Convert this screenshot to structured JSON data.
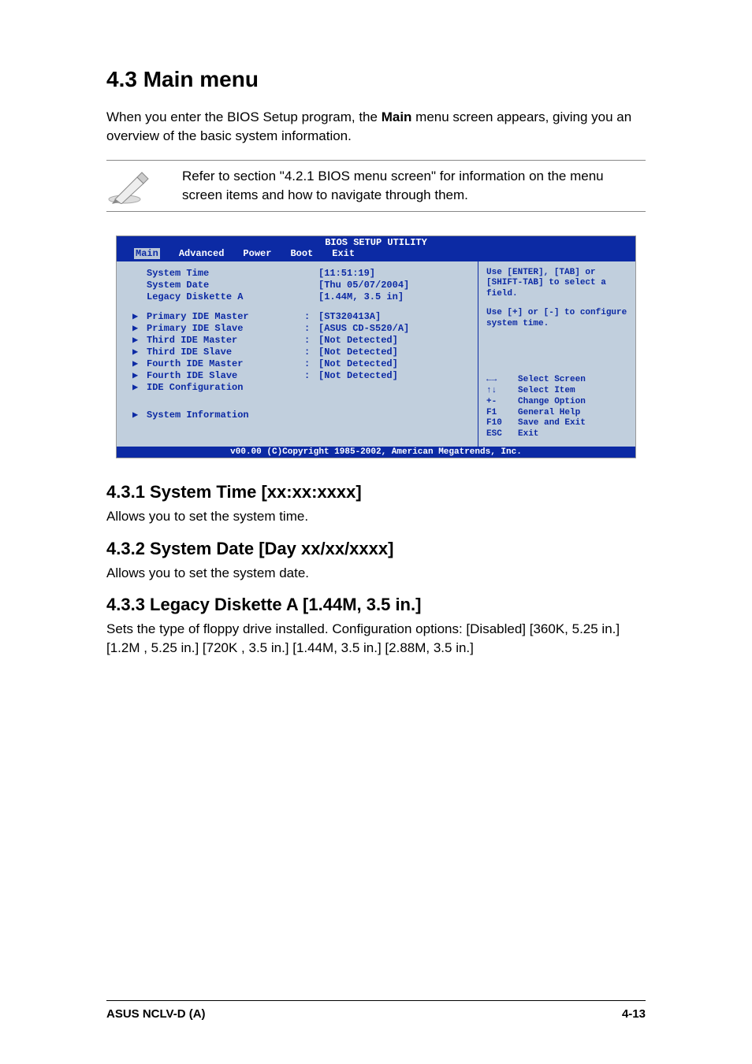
{
  "heading": "4.3    Main menu",
  "intro_pre": "When you enter the BIOS Setup program, the ",
  "intro_bold": "Main",
  "intro_post": " menu screen appears, giving you an overview of the basic system information.",
  "note": "Refer to section \"4.2.1  BIOS menu screen\" for information on the menu screen items and how to navigate through them.",
  "bios": {
    "title": "BIOS SETUP UTILITY",
    "menu": {
      "main": "Main",
      "advanced": "Advanced",
      "power": "Power",
      "boot": "Boot",
      "exit": "Exit"
    },
    "rows_top": [
      {
        "label": "System Time",
        "val": "[11:51:19]"
      },
      {
        "label": "System Date",
        "val": "[Thu 05/07/2004]"
      },
      {
        "label": "Legacy Diskette A",
        "val": "[1.44M, 3.5 in]"
      }
    ],
    "rows_ide": [
      {
        "label": "Primary IDE Master",
        "val": "[ST320413A]"
      },
      {
        "label": "Primary IDE Slave",
        "val": "[ASUS CD-S520/A]"
      },
      {
        "label": "Third IDE Master",
        "val": "[Not Detected]"
      },
      {
        "label": "Third IDE Slave",
        "val": "[Not Detected]"
      },
      {
        "label": "Fourth IDE Master",
        "val": "[Not Detected]"
      },
      {
        "label": "Fourth IDE Slave",
        "val": "[Not Detected]"
      },
      {
        "label": "IDE Configuration",
        "val": ""
      }
    ],
    "rows_sys": [
      {
        "label": "System Information",
        "val": ""
      }
    ],
    "help_top": "Use [ENTER], [TAB] or [SHIFT-TAB] to select a field.",
    "help_mid": "Use [+] or [-] to configure system time.",
    "help_nav": [
      {
        "key": "←→",
        "txt": "Select Screen"
      },
      {
        "key": "↑↓",
        "txt": "Select Item"
      },
      {
        "key": "+-",
        "txt": "Change Option"
      },
      {
        "key": "F1",
        "txt": "General Help"
      },
      {
        "key": "F10",
        "txt": "Save and Exit"
      },
      {
        "key": "ESC",
        "txt": "Exit"
      }
    ],
    "footer": "v00.00 (C)Copyright 1985-2002, American Megatrends, Inc."
  },
  "sections": [
    {
      "h": "4.3.1   System Time [xx:xx:xxxx]",
      "p": "Allows you to set the system time."
    },
    {
      "h": "4.3.2   System Date [Day xx/xx/xxxx]",
      "p": "Allows you to set the system date."
    },
    {
      "h": "4.3.3   Legacy Diskette A [1.44M, 3.5 in.]",
      "p": "Sets the type of floppy drive installed. Configuration options: [Disabled] [360K, 5.25 in.] [1.2M , 5.25 in.] [720K , 3.5 in.] [1.44M, 3.5 in.] [2.88M, 3.5 in.]"
    }
  ],
  "footer_left": "ASUS NCLV-D (A)",
  "footer_right": "4-13"
}
